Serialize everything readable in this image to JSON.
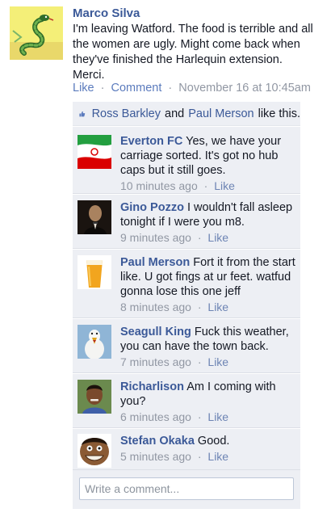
{
  "post": {
    "author": "Marco Silva",
    "text": "I'm leaving Watford. The food is terrible and all the women are ugly. Might come back when they've finished the Harlequin extension. Merci.",
    "like_label": "Like",
    "comment_label": "Comment",
    "timestamp": "November 16 at 10:45am",
    "separator": "·"
  },
  "likes": {
    "user1": "Ross Barkley",
    "and": "and",
    "user2": "Paul Merson",
    "suffix": "like this.",
    "icon": "thumbs-up-icon"
  },
  "comments": [
    {
      "author": "Everton FC",
      "text": "Yes, we have your carriage sorted. It's got no hub caps but it still goes.",
      "time": "10 minutes ago",
      "like": "Like",
      "avatar": "flag-avatar"
    },
    {
      "author": "Gino Pozzo",
      "text": "I wouldn't fall asleep tonight if I were you m8.",
      "time": "9 minutes ago",
      "like": "Like",
      "avatar": "godfather-avatar"
    },
    {
      "author": "Paul Merson",
      "text": "Fort it from the start like. U got fings at ur feet. watfud gonna lose this one jeff",
      "time": "8 minutes ago",
      "like": "Like",
      "avatar": "beer-pint-avatar"
    },
    {
      "author": "Seagull King",
      "text": "Fuck this weather, you can have the town back.",
      "time": "7 minutes ago",
      "like": "Like",
      "avatar": "seagull-avatar"
    },
    {
      "author": "Richarlison",
      "text": "Am I coming with you?",
      "time": "6 minutes ago",
      "like": "Like",
      "avatar": "boy-avatar"
    },
    {
      "author": "Stefan Okaka",
      "text": "Good.",
      "time": "5 minutes ago",
      "like": "Like",
      "avatar": "cartoon-face-avatar"
    }
  ],
  "composer": {
    "placeholder": "Write a comment..."
  },
  "colors": {
    "link": "#3b5998",
    "feedback_bg": "#edeff4",
    "meta": "#9197a3"
  }
}
